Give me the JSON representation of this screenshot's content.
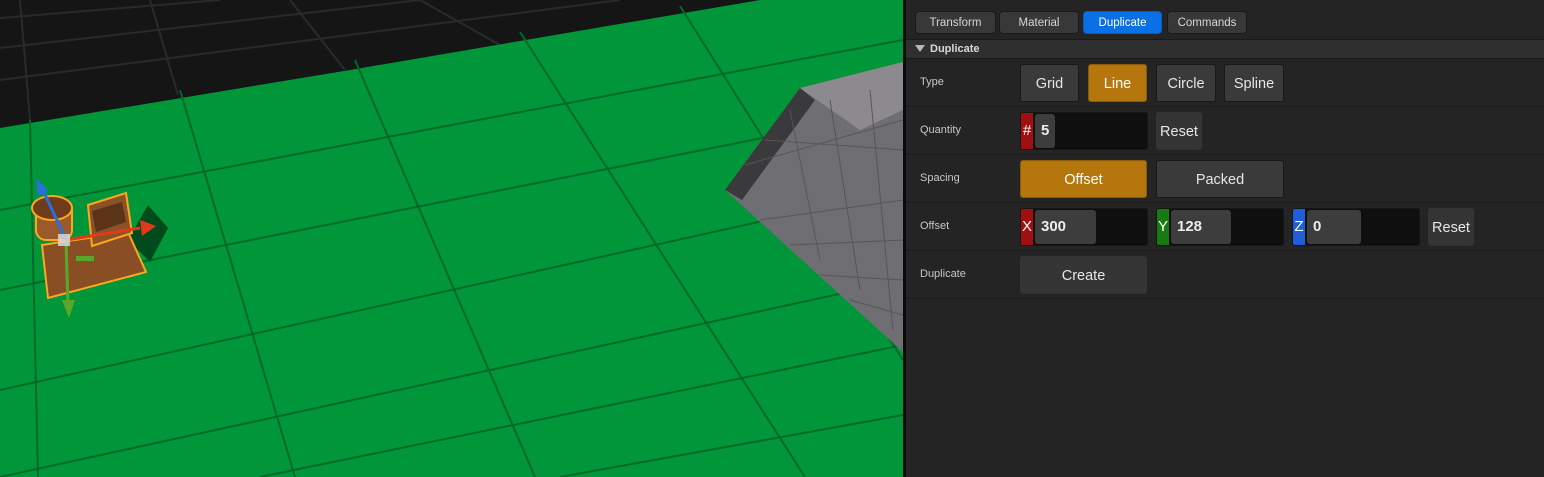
{
  "tabs": [
    {
      "label": "Transform",
      "active": false
    },
    {
      "label": "Material",
      "active": false
    },
    {
      "label": "Duplicate",
      "active": true
    },
    {
      "label": "Commands",
      "active": false
    }
  ],
  "section": {
    "title": "Duplicate",
    "expanded": true
  },
  "type_row": {
    "label": "Type",
    "options": [
      "Grid",
      "Line",
      "Circle",
      "Spline"
    ],
    "selected": "Line"
  },
  "quantity_row": {
    "label": "Quantity",
    "prefix": "#",
    "value": "5",
    "reset_label": "Reset"
  },
  "spacing_row": {
    "label": "Spacing",
    "options": [
      "Offset",
      "Packed"
    ],
    "selected": "Offset"
  },
  "offset_row": {
    "label": "Offset",
    "x_label": "X",
    "x_value": "300",
    "y_label": "Y",
    "y_value": "128",
    "z_label": "Z",
    "z_value": "0",
    "reset_label": "Reset"
  },
  "duplicate_row": {
    "label": "Duplicate",
    "button_label": "Create"
  },
  "colors": {
    "accent_active_tab": "#0a70e6",
    "selected_option": "#b5770d",
    "floor_green": "#009639",
    "gizmo_x": "#e03a1a",
    "gizmo_y": "#5aa82a",
    "gizmo_z": "#2a6fe0",
    "selection_outline": "#ffa51f"
  }
}
